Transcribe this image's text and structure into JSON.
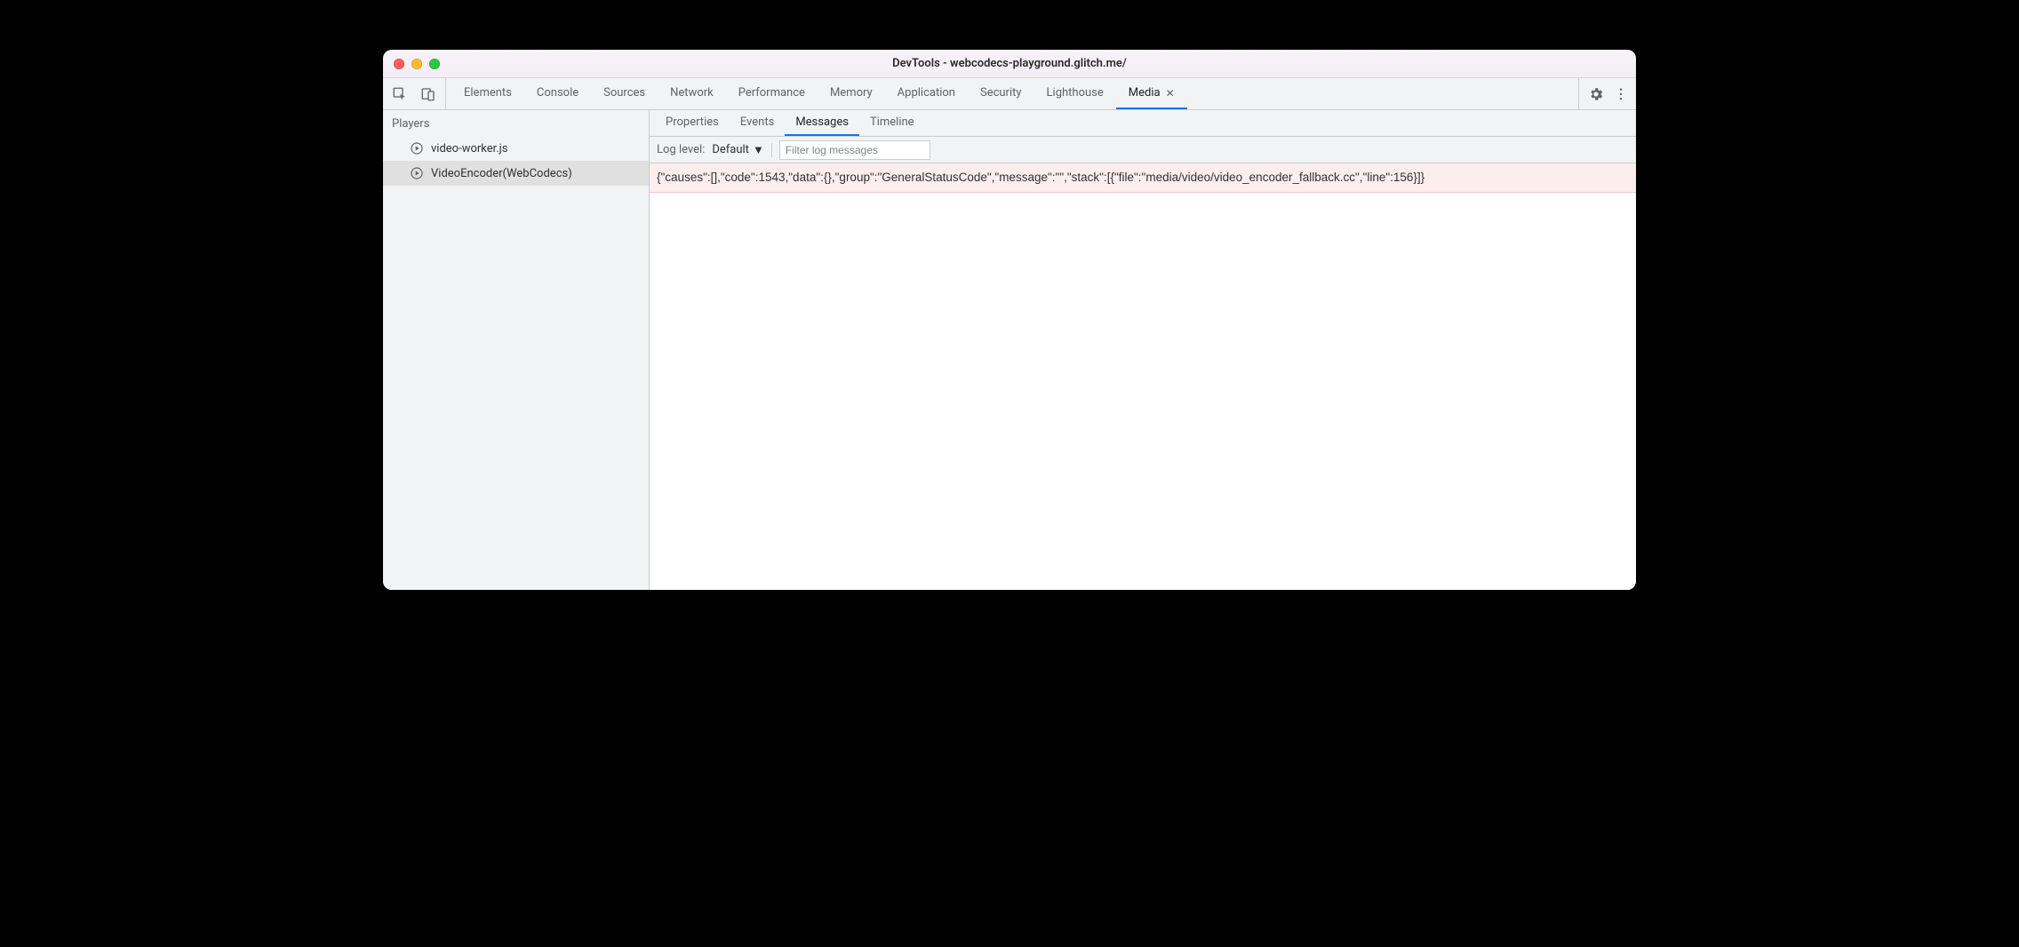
{
  "window": {
    "title": "DevTools - webcodecs-playground.glitch.me/"
  },
  "panels": [
    "Elements",
    "Console",
    "Sources",
    "Network",
    "Performance",
    "Memory",
    "Application",
    "Security",
    "Lighthouse",
    "Media"
  ],
  "panels_active_index": 9,
  "panels_closable_index": 9,
  "sidebar": {
    "title": "Players",
    "items": [
      {
        "label": "video-worker.js"
      },
      {
        "label": "VideoEncoder(WebCodecs)"
      }
    ],
    "selected_index": 1
  },
  "subtabs": [
    "Properties",
    "Events",
    "Messages",
    "Timeline"
  ],
  "subtabs_active_index": 2,
  "filter": {
    "label": "Log level:",
    "level": "Default",
    "placeholder": "Filter log messages"
  },
  "messages": [
    "{\"causes\":[],\"code\":1543,\"data\":{},\"group\":\"GeneralStatusCode\",\"message\":\"\",\"stack\":[{\"file\":\"media/video/video_encoder_fallback.cc\",\"line\":156}]}"
  ]
}
